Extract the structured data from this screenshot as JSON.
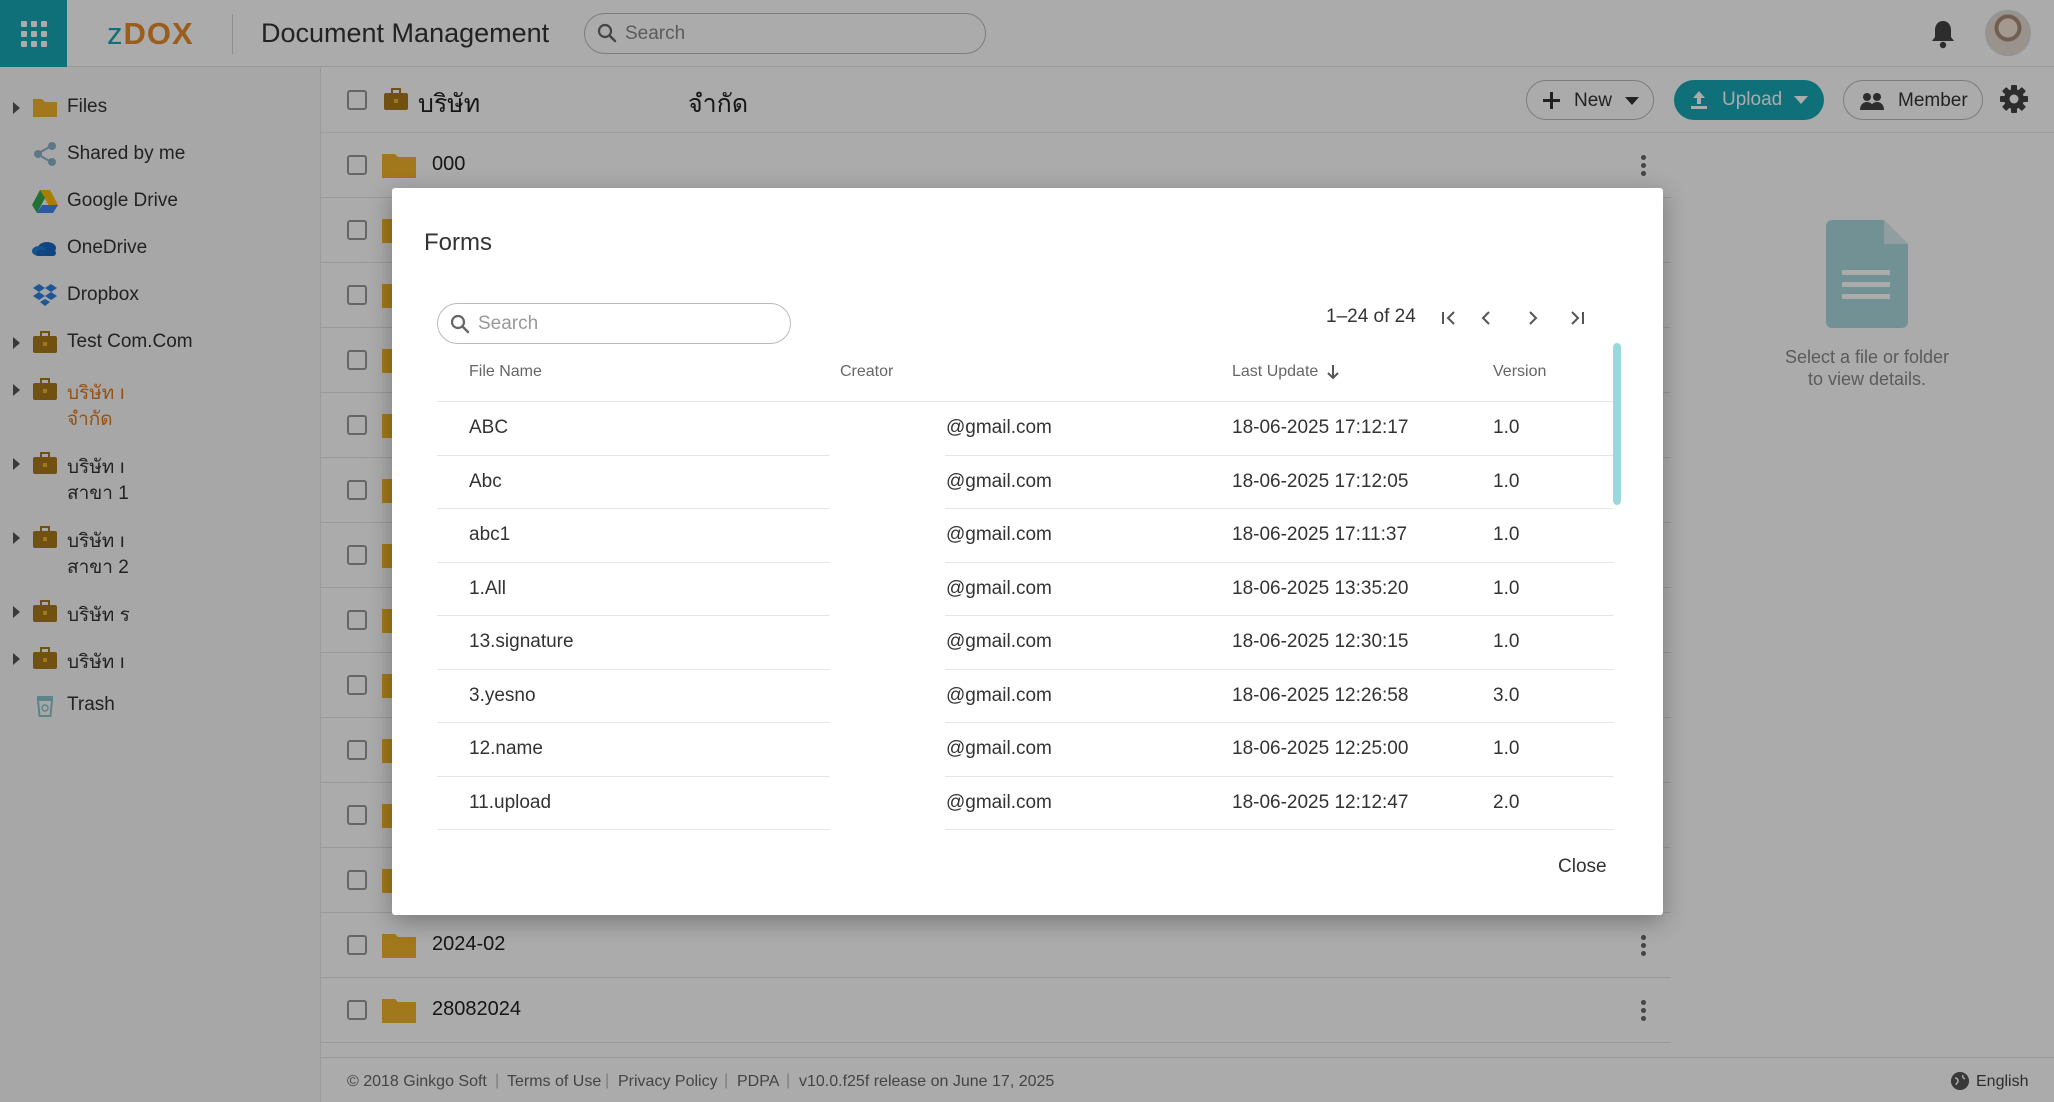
{
  "topbar": {
    "logo_z": "z",
    "logo_rest": "DOX",
    "title": "Document Management",
    "search_placeholder": "Search"
  },
  "sidebar": {
    "items": [
      {
        "label": "Files",
        "line2": "",
        "icon": "folder-icon",
        "caret": true
      },
      {
        "label": "Shared by me",
        "line2": "",
        "icon": "share-icon",
        "caret": false
      },
      {
        "label": "Google Drive",
        "line2": "",
        "icon": "google-drive-icon",
        "caret": false
      },
      {
        "label": "OneDrive",
        "line2": "",
        "icon": "onedrive-icon",
        "caret": false
      },
      {
        "label": "Dropbox",
        "line2": "",
        "icon": "dropbox-icon",
        "caret": false
      },
      {
        "label": "Test Com.Com",
        "line2": "",
        "icon": "briefcase-icon",
        "caret": true
      },
      {
        "label": "บริษัท ı",
        "line2": "จำกัด",
        "icon": "briefcase-icon",
        "caret": true,
        "active": true
      },
      {
        "label": "บริษัท ı",
        "line2": "สาขา 1",
        "icon": "briefcase-icon",
        "caret": true
      },
      {
        "label": "บริษัท ı",
        "line2": "สาขา 2",
        "icon": "briefcase-icon",
        "caret": true
      },
      {
        "label": "บริษัท ร",
        "line2": "",
        "icon": "briefcase-icon",
        "caret": true
      },
      {
        "label": "บริษัท ı",
        "line2": "",
        "icon": "briefcase-icon",
        "caret": true
      },
      {
        "label": "Trash",
        "line2": "",
        "icon": "trash-icon",
        "caret": false
      }
    ]
  },
  "header": {
    "breadcrumb_name": "บริษัท",
    "breadcrumb_suffix": "จำกัด",
    "new_label": "New",
    "upload_label": "Upload",
    "member_label": "Member"
  },
  "files": {
    "first": "000",
    "last": [
      "2024-02",
      "28082024"
    ]
  },
  "details": {
    "line1": "Select a file or folder",
    "line2": "to view details."
  },
  "footer": {
    "copyright": "© 2018 Ginkgo Soft",
    "terms": "Terms of Use",
    "privacy": "Privacy Policy",
    "pdpa": "PDPA",
    "version": "v10.0.f25f release on June 17, 2025",
    "language": "English"
  },
  "modal": {
    "title": "Forms",
    "search_placeholder": "Search",
    "pager": "1–24 of 24",
    "columns": {
      "file_name": "File Name",
      "creator": "Creator",
      "last_update": "Last Update",
      "version": "Version"
    },
    "rows": [
      {
        "name": "ABC",
        "creator": "@gmail.com",
        "updated": "18-06-2025 17:12:17",
        "version": "1.0"
      },
      {
        "name": "Abc",
        "creator": "@gmail.com",
        "updated": "18-06-2025 17:12:05",
        "version": "1.0"
      },
      {
        "name": "abc1",
        "creator": "@gmail.com",
        "updated": "18-06-2025 17:11:37",
        "version": "1.0"
      },
      {
        "name": "1.All",
        "creator": "@gmail.com",
        "updated": "18-06-2025 13:35:20",
        "version": "1.0"
      },
      {
        "name": "13.signature",
        "creator": "@gmail.com",
        "updated": "18-06-2025 12:30:15",
        "version": "1.0"
      },
      {
        "name": "3.yesno",
        "creator": "@gmail.com",
        "updated": "18-06-2025 12:26:58",
        "version": "3.0"
      },
      {
        "name": "12.name",
        "creator": "@gmail.com",
        "updated": "18-06-2025 12:25:00",
        "version": "1.0"
      },
      {
        "name": "11.upload",
        "creator": "@gmail.com",
        "updated": "18-06-2025 12:12:47",
        "version": "2.0"
      }
    ],
    "close_label": "Close"
  },
  "colors": {
    "accent": "#18a7b5",
    "brand_orange": "#e78b2b",
    "folder": "#f0b32a",
    "active_sidebar": "#e07a20"
  }
}
